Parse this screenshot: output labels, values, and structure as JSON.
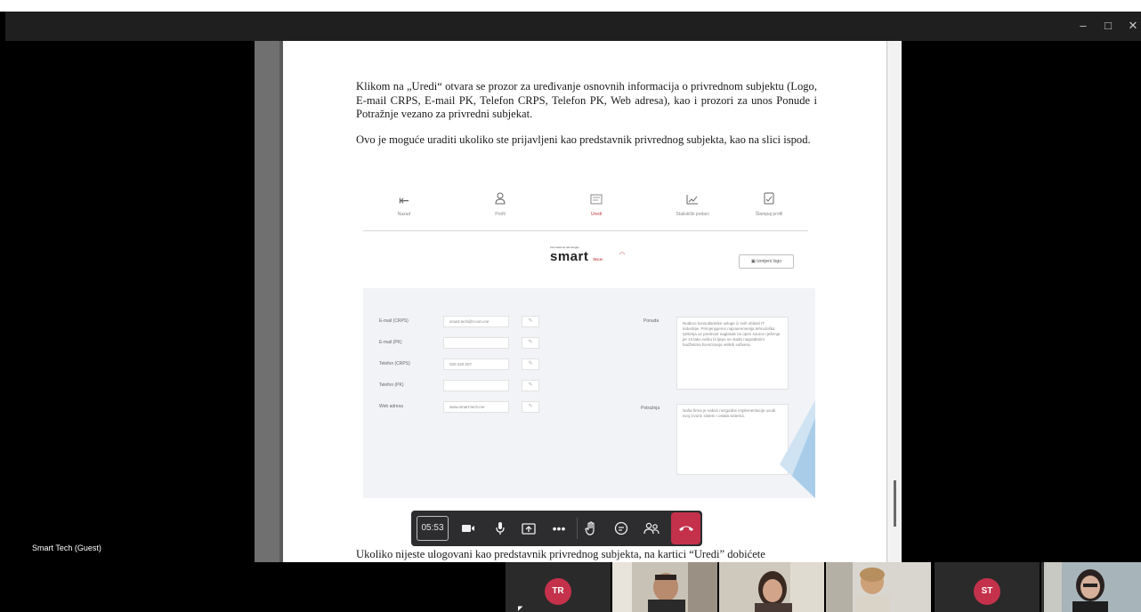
{
  "window": {
    "minimize": "–",
    "maximize": "□",
    "close": "✕"
  },
  "document": {
    "paragraph1": "Klikom na „Uredi“ otvara se prozor za uređivanje osnovnih informacija o privrednom subjektu (Logo, E-mail CRPS, E-mail PK, Telefon CRPS, Telefon PK, Web adresa), kao i prozori za unos Ponude i Potražnje vezano za privredni subjekat.",
    "paragraph2": "Ovo je moguće uraditi ukoliko ste prijavljeni kao predstavnik privrednog subjekta, kao na slici ispod.",
    "paragraph3": "Ukoliko nijeste ulogovani kao predstavnik privrednog subjekta, na kartici “Uredi” dobićete"
  },
  "embedded": {
    "nav": [
      {
        "label": "Nazad",
        "icon": "exit-icon"
      },
      {
        "label": "Profil",
        "icon": "user-icon"
      },
      {
        "label": "Uredi",
        "icon": "edit-icon"
      },
      {
        "label": "Statistički podaci",
        "icon": "chart-icon"
      },
      {
        "label": "Štampaj profil",
        "icon": "print-icon"
      }
    ],
    "logo": {
      "small": "informacione tehnologije",
      "main": "smart",
      "sub": "TECH"
    },
    "change_logo": "Izmijeni logo",
    "fields": [
      {
        "label": "E-mail (CRPS)",
        "value": "smart.tech@t-com.me"
      },
      {
        "label": "E-mail (PK)",
        "value": ""
      },
      {
        "label": "Telefon (CRPS)",
        "value": "020 220 007"
      },
      {
        "label": "Telefon (PK)",
        "value": ""
      },
      {
        "label": "Web adresa",
        "value": "www.smart-tech.me"
      }
    ],
    "ponuda_label": "Ponuda",
    "ponuda_text": "Nudimo konsultantske usluge iz svih oblasti IT industrije. Primjenjujemo najsavremenija tehnološka rješenja uz prednost naglasak na open source rješenja jer za tako nešto bi ljepo ne stađu nagrađenim budžetima licenciranja velikih softvera.",
    "potraznja_label": "Potražnja",
    "potraznja_text": "Naša firma je nakon nezgodne implementacije uvodi svoj izvorni sistem i ostala sistema."
  },
  "meeting": {
    "timer": "05:53",
    "guest_name": "Smart Tech (Guest)",
    "toolbar": [
      {
        "name": "camera-button",
        "icon": "camera-icon"
      },
      {
        "name": "mic-button",
        "icon": "mic-icon"
      },
      {
        "name": "share-button",
        "icon": "share-icon"
      },
      {
        "name": "more-button",
        "icon": "more-icon"
      },
      {
        "name": "raise-hand-button",
        "icon": "hand-icon"
      },
      {
        "name": "chat-button",
        "icon": "chat-icon"
      },
      {
        "name": "participants-button",
        "icon": "people-icon"
      },
      {
        "name": "leave-button",
        "icon": "hangup-icon"
      }
    ],
    "participants": [
      {
        "initials": "TR",
        "color": "#c4314b",
        "type": "avatar"
      },
      {
        "initials": "",
        "type": "video"
      },
      {
        "initials": "",
        "type": "video"
      },
      {
        "initials": "",
        "type": "video"
      },
      {
        "initials": "ST",
        "color": "#c4314b",
        "type": "avatar"
      },
      {
        "initials": "",
        "type": "video"
      }
    ]
  }
}
